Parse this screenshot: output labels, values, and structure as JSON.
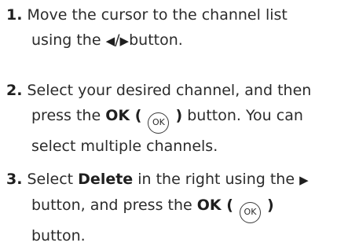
{
  "steps": [
    {
      "number": "1.",
      "line1": "Move the cursor to the channel list",
      "line2_prefix": "using the ",
      "left_arrow": "◀",
      "slash": "/",
      "right_arrow": "▶",
      "line2_suffix": "button."
    },
    {
      "number": "2.",
      "line1": "Select your desired channel, and then",
      "line2_prefix": "press the ",
      "ok_open": "OK (",
      "ok_icon": "OK",
      "ok_close": ")",
      "line2_suffix": " button. You can",
      "line3": "select multiple channels."
    },
    {
      "number": "3.",
      "line1_prefix": "Select ",
      "delete_label": "Delete",
      "line1_suffix": " in the right using the ",
      "right_arrow": "▶",
      "line2_prefix": "button, and press the ",
      "ok_open": "OK (",
      "ok_icon": "OK",
      "ok_close": ")",
      "line3": "button."
    }
  ]
}
